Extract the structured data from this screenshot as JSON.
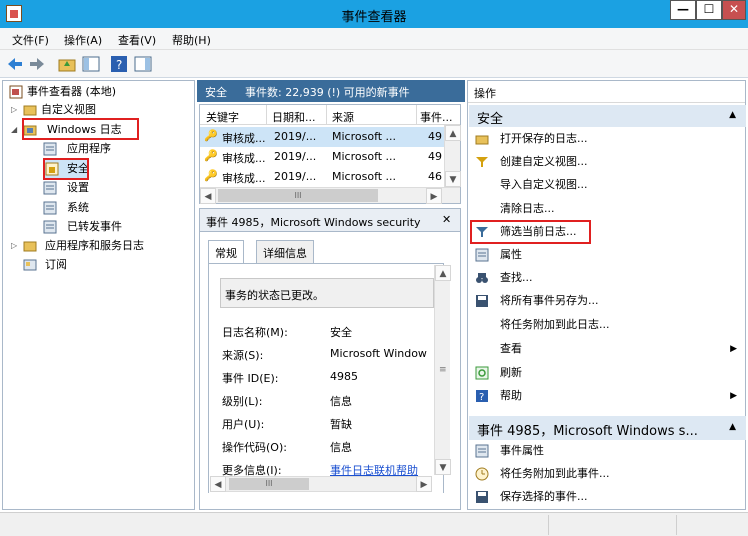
{
  "window": {
    "title": "事件查看器",
    "min": "—",
    "max": "☐",
    "close": "✕"
  },
  "menu": [
    "文件(F)",
    "操作(A)",
    "查看(V)",
    "帮助(H)"
  ],
  "tree": {
    "root": "事件查看器 (本地)",
    "custom_views": "自定义视图",
    "windows_logs": "Windows 日志",
    "application": "应用程序",
    "security": "安全",
    "setup": "设置",
    "system": "系统",
    "forwarded": "已转发事件",
    "app_services": "应用程序和服务日志",
    "subscriptions": "订阅"
  },
  "middle": {
    "header_name": "安全",
    "header_info": "事件数: 22,939 (!) 可用的新事件",
    "columns": [
      "关键字",
      "日期和...",
      "来源",
      "事件..."
    ],
    "rows": [
      [
        "审核成...",
        "2019/...",
        "Microsoft ...",
        "49"
      ],
      [
        "审核成...",
        "2019/...",
        "Microsoft ...",
        "49"
      ],
      [
        "审核成...",
        "2019/...",
        "Microsoft ...",
        "46"
      ]
    ],
    "hscroll_thumb": "III"
  },
  "detail": {
    "title": "事件 4985，Microsoft Windows security",
    "close": "✕",
    "tabs": [
      "常规",
      "详细信息"
    ],
    "message": "事务的状态已更改。",
    "props": [
      {
        "label": "日志名称(M):",
        "value": "安全"
      },
      {
        "label": "来源(S):",
        "value": "Microsoft Window"
      },
      {
        "label": "事件 ID(E):",
        "value": "4985"
      },
      {
        "label": "级别(L):",
        "value": "信息"
      },
      {
        "label": "用户(U):",
        "value": "暂缺"
      },
      {
        "label": "操作代码(O):",
        "value": "信息"
      },
      {
        "label": "更多信息(I):",
        "value": "事件日志联机帮助"
      }
    ],
    "hscroll_thumb": "III"
  },
  "actions": {
    "title": "操作",
    "section1": "安全",
    "items1": [
      {
        "icon": "folder-open-icon",
        "label": "打开保存的日志..."
      },
      {
        "icon": "filter-icon",
        "label": "创建自定义视图..."
      },
      {
        "icon": "",
        "label": "导入自定义视图..."
      },
      {
        "icon": "",
        "label": "清除日志..."
      },
      {
        "icon": "filter-icon",
        "label": "筛选当前日志..."
      },
      {
        "icon": "properties-icon",
        "label": "属性"
      },
      {
        "icon": "binoculars-icon",
        "label": "查找..."
      },
      {
        "icon": "save-icon",
        "label": "将所有事件另存为..."
      },
      {
        "icon": "",
        "label": "将任务附加到此日志..."
      },
      {
        "icon": "",
        "label": "查看"
      },
      {
        "icon": "refresh-icon",
        "label": "刷新"
      },
      {
        "icon": "help-icon",
        "label": "帮助"
      }
    ],
    "section2": "事件 4985，Microsoft Windows s...",
    "items2": [
      {
        "icon": "event-properties-icon",
        "label": "事件属性"
      },
      {
        "icon": "task-icon",
        "label": "将任务附加到此事件..."
      },
      {
        "icon": "save-icon",
        "label": "保存选择的事件..."
      }
    ]
  }
}
